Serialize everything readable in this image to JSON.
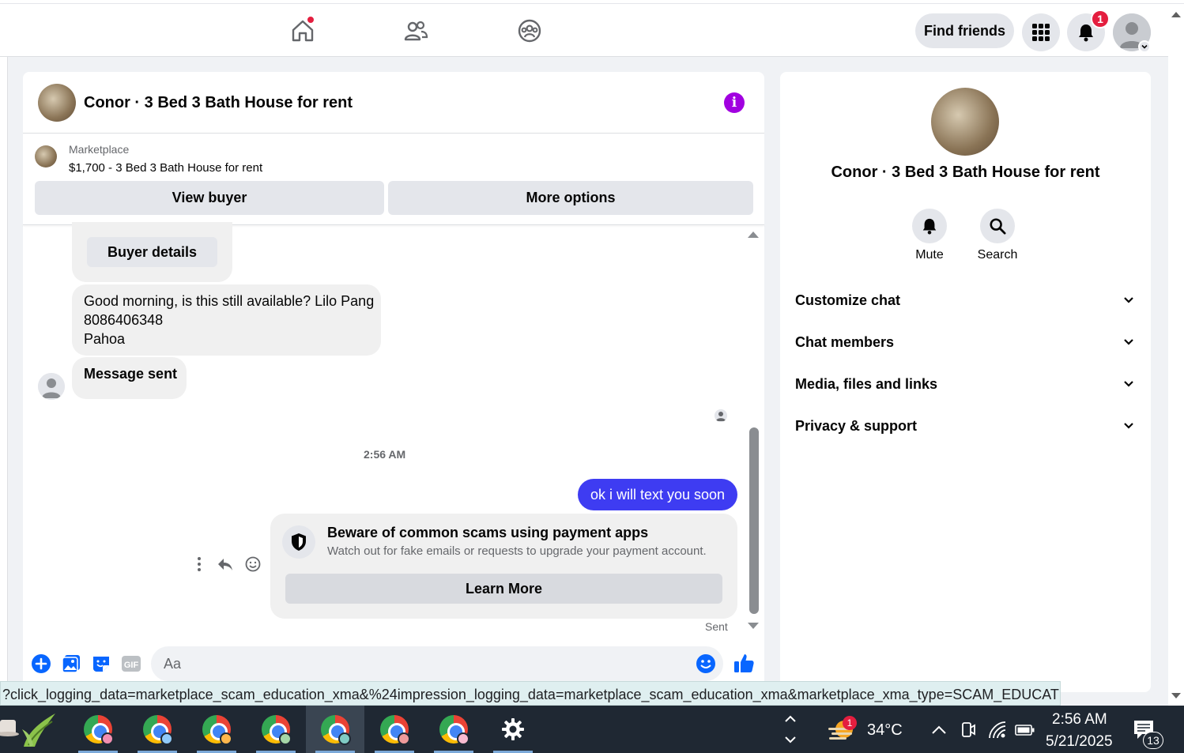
{
  "colors": {
    "accent": "#0866ff",
    "bubble_blue": "#3e3cf2",
    "info_purple": "#a100e0",
    "badge_red": "#e41e3f"
  },
  "topnav": {
    "icons": [
      "home-icon",
      "friends-icon",
      "groups-icon"
    ],
    "find_friends": "Find friends",
    "notification_count": "1"
  },
  "chat": {
    "title": "Conor · 3 Bed 3 Bath House for rent",
    "marketplace_label": "Marketplace",
    "listing": "$1,700 - 3 Bed 3 Bath House for rent",
    "view_buyer": "View buyer",
    "more_options": "More options",
    "buyer_details": "Buyer details",
    "incoming_message_lines": [
      "Good morning, is this still available? Lilo Pang",
      "8086406348",
      "Pahoa"
    ],
    "message_sent": "Message sent",
    "timestamp": "2:56 AM",
    "outgoing_message": "ok i will text you soon",
    "scam_title": "Beware of common scams using payment apps",
    "scam_sub": "Watch out for fake emails or requests to upgrade your payment account.",
    "learn_more": "Learn More",
    "sent_status": "Sent",
    "composer_placeholder": "Aa"
  },
  "right_panel": {
    "title": "Conor · 3 Bed 3 Bath House for rent",
    "mute": "Mute",
    "search": "Search",
    "sections": [
      "Customize chat",
      "Chat members",
      "Media, files and links",
      "Privacy & support"
    ]
  },
  "statusbar": {
    "url": "?click_logging_data=marketplace_scam_education_xma&%24impression_logging_data=marketplace_scam_education_xma&marketplace_xma_type=SCAM_EDUCATION"
  },
  "taskbar": {
    "weather": "34°C",
    "weather_badge": "1",
    "time": "2:56 AM",
    "date": "5/21/2025",
    "notifications": "13"
  }
}
